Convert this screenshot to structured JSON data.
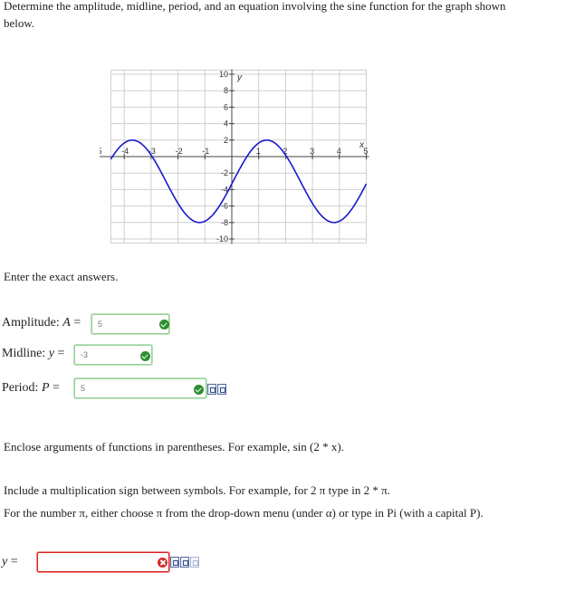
{
  "question": {
    "prompt": "Determine the amplitude, midline, period, and an equation involving the sine function for the graph shown below."
  },
  "graph": {
    "x_axis_label": "x",
    "y_axis_label": "y",
    "x_ticks": [
      "-5",
      "-4",
      "-3",
      "-2",
      "-1",
      "1",
      "2",
      "3",
      "4",
      "5"
    ],
    "y_ticks": [
      "10",
      "8",
      "6",
      "4",
      "2",
      "-2",
      "-4",
      "-6",
      "-8",
      "-10"
    ],
    "curve_color": "#1a1acc",
    "grid": true
  },
  "instructions": {
    "exact": "Enter the exact answers."
  },
  "amplitude": {
    "label": "Amplitude: ",
    "var": "A",
    "eq": " =",
    "value": "5"
  },
  "midline": {
    "label": "Midline: ",
    "var": "y",
    "eq": " =",
    "value": "-3"
  },
  "period": {
    "label": "Period: ",
    "var": "P",
    "eq": " =",
    "value": "5"
  },
  "hints": {
    "parens": "Enclose arguments of functions in parentheses. For example, sin (2 * x).",
    "mult": "Include a multiplication sign between symbols. For example, for 2 π type in 2 * π.",
    "pi": "For the number π, either choose π from the drop-down menu (under α) or type in Pi (with a capital P)."
  },
  "equation": {
    "var": "y",
    "eq": " =",
    "value": ""
  },
  "colors": {
    "correct": "#2f8f2f",
    "incorrect": "#d62828",
    "input_ok_border": "#9ad19a",
    "input_bad_border": "#e02020"
  }
}
